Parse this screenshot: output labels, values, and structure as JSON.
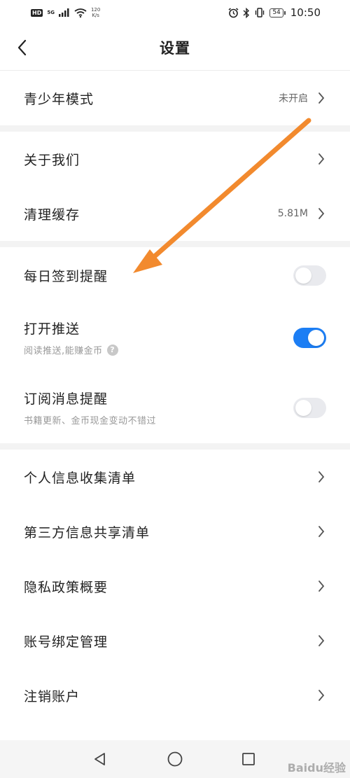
{
  "status_bar": {
    "hd": "HD",
    "network_gen": "5G",
    "speed_value": "120",
    "speed_unit": "K/s",
    "battery": "54",
    "time": "10:50"
  },
  "header": {
    "title": "设置"
  },
  "rows": {
    "youth": {
      "label": "青少年模式",
      "value": "未开启"
    },
    "about": {
      "label": "关于我们"
    },
    "cache": {
      "label": "清理缓存",
      "value": "5.81M"
    },
    "checkin": {
      "label": "每日签到提醒",
      "toggle_on": false
    },
    "push": {
      "label": "打开推送",
      "sub": "阅读推送,能赚金币",
      "toggle_on": true
    },
    "subscribe": {
      "label": "订阅消息提醒",
      "sub": "书籍更新、金币现金变动不错过",
      "toggle_on": false
    },
    "personal_info": {
      "label": "个人信息收集清单"
    },
    "third_party": {
      "label": "第三方信息共享清单"
    },
    "privacy": {
      "label": "隐私政策概要"
    },
    "account_binding": {
      "label": "账号绑定管理"
    },
    "delete_account": {
      "label": "注销账户"
    }
  },
  "colors": {
    "toggle_on": "#1c7ef4",
    "toggle_off": "#e9eaee",
    "annotation_arrow": "#f28a2e"
  },
  "watermark": "Baidu经验"
}
